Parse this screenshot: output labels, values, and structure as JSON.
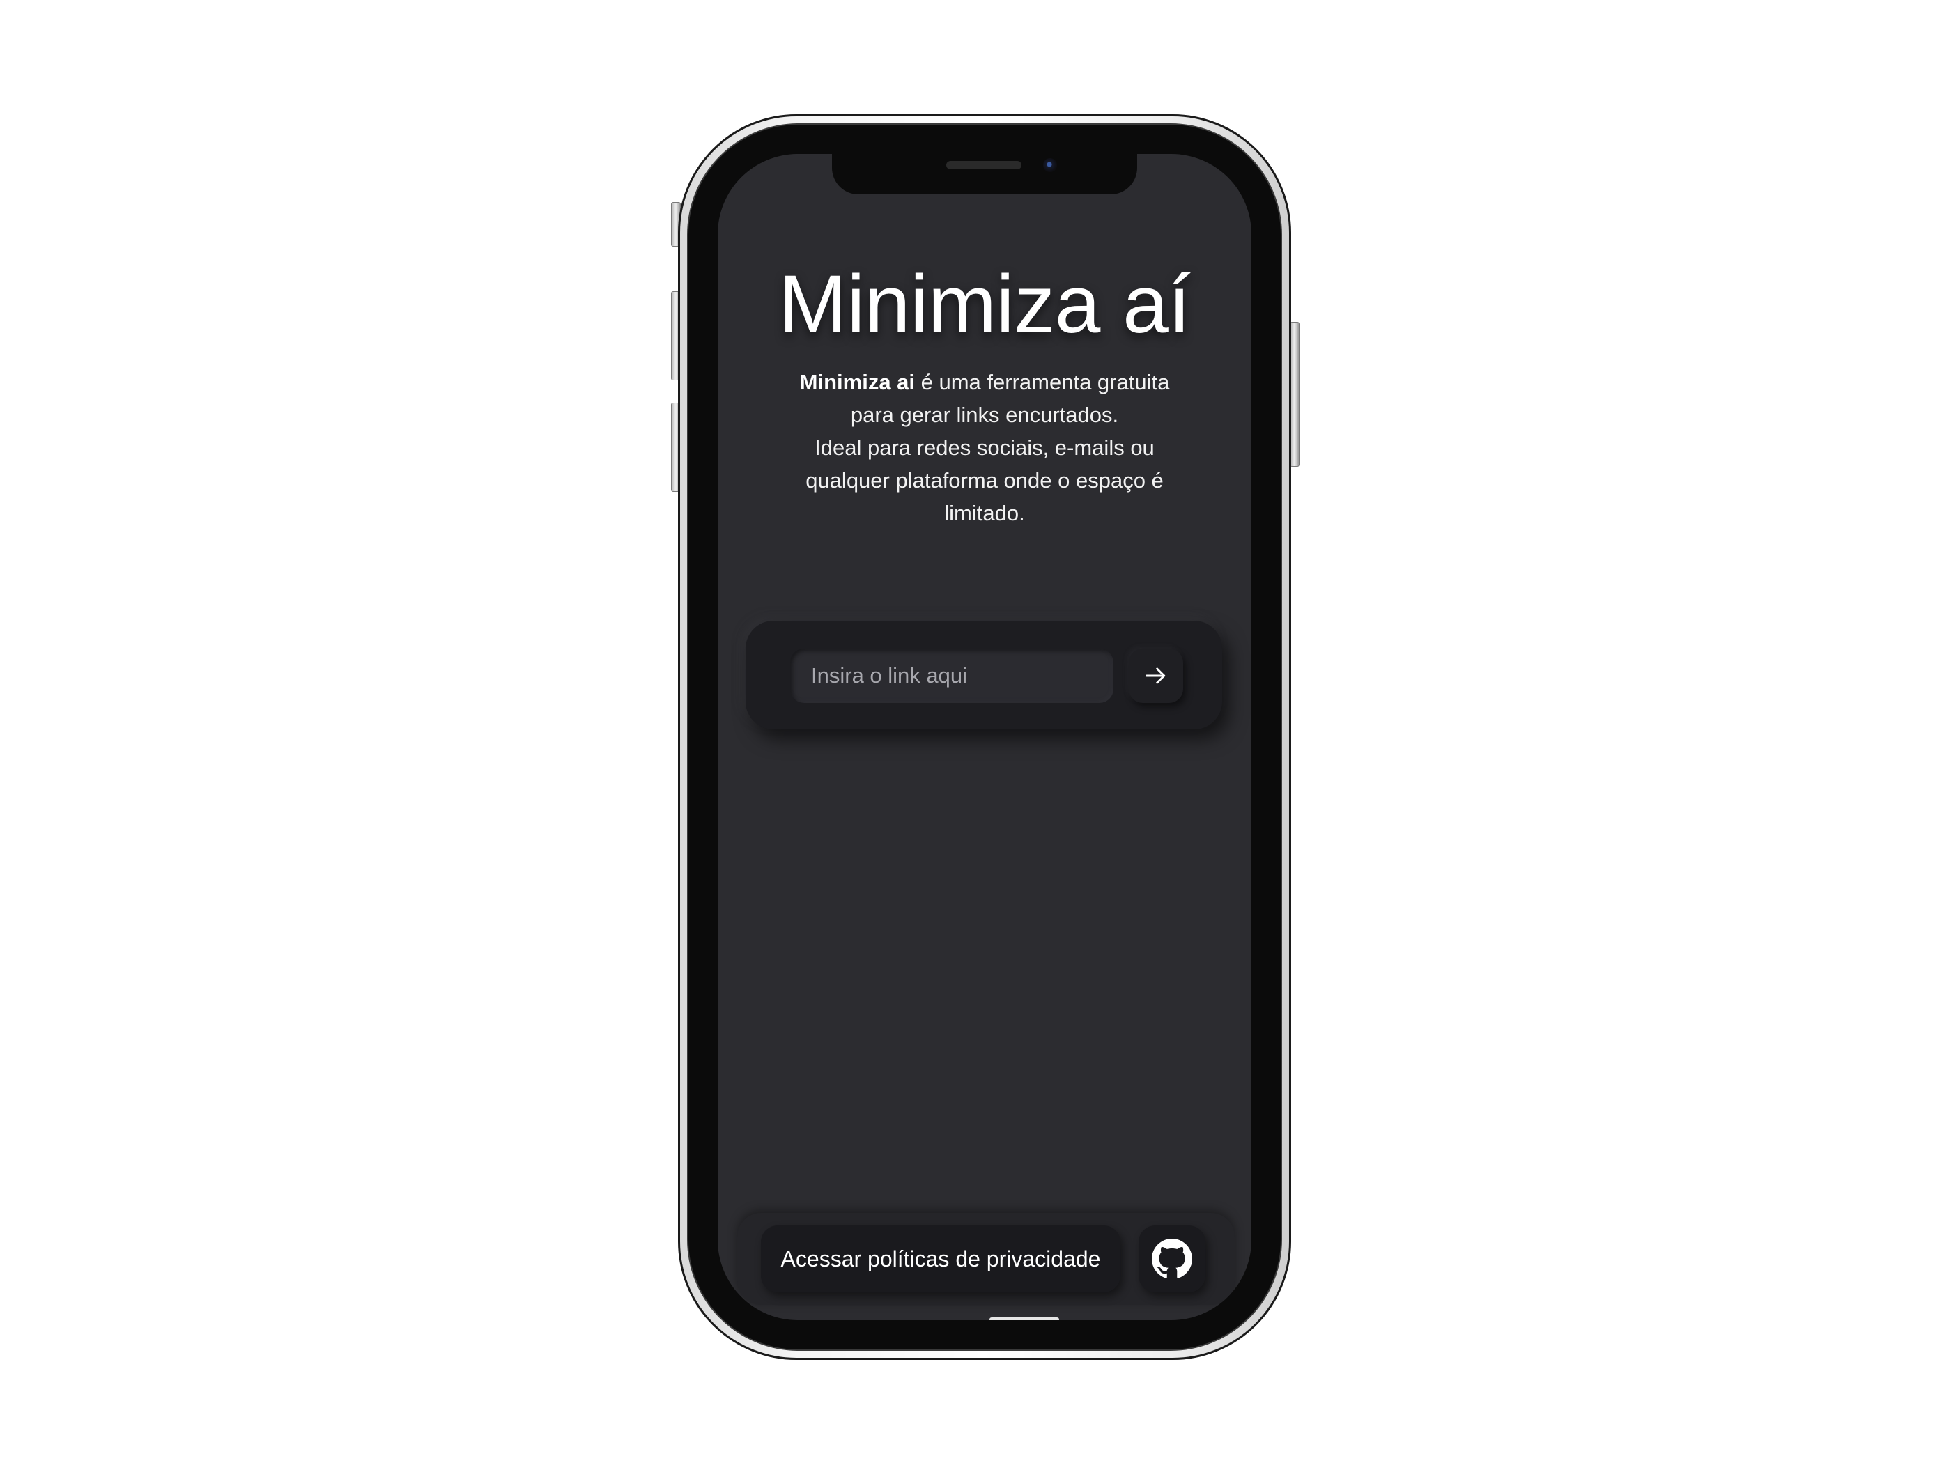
{
  "app": {
    "title": "Minimiza aí",
    "description": {
      "brand": "Minimiza ai",
      "line1_rest": " é uma ferramenta gratuita para gerar links encurtados.",
      "line2": "Ideal para redes sociais, e-mails ou qualquer plataforma onde o espaço é limitado."
    }
  },
  "form": {
    "link_placeholder": "Insira o link aqui",
    "link_value": "",
    "submit_icon": "arrow-right-icon"
  },
  "footer": {
    "privacy_label": "Acessar políticas de privacidade",
    "github_icon": "github-icon"
  },
  "colors": {
    "screen_bg": "#2c2c30",
    "card_bg": "#1d1d21",
    "text": "#ffffff"
  }
}
